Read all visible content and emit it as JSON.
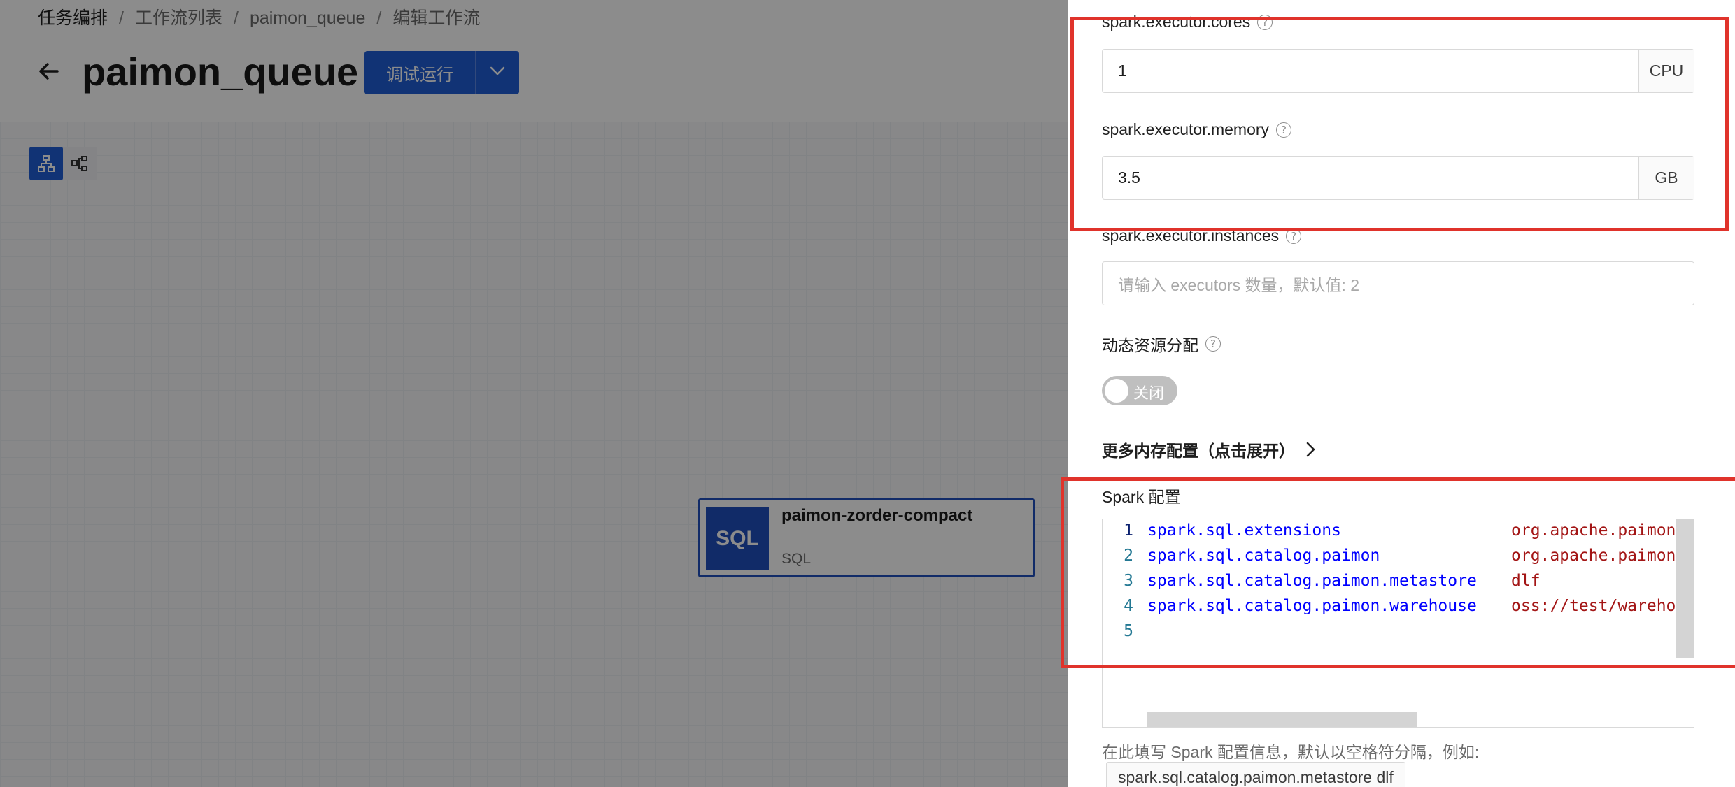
{
  "breadcrumb": {
    "items": [
      "任务编排",
      "工作流列表",
      "paimon_queue",
      "编辑工作流"
    ],
    "separator": "/"
  },
  "workflow": {
    "title": "paimon_queue",
    "run_button": "调试运行"
  },
  "node": {
    "icon_text": "SQL",
    "name": "paimon-zorder-compact",
    "type": "SQL"
  },
  "drawer": {
    "executor_cores": {
      "label": "spark.executor.cores",
      "value": "1",
      "unit": "CPU"
    },
    "executor_memory": {
      "label": "spark.executor.memory",
      "value": "3.5",
      "unit": "GB"
    },
    "executor_instances": {
      "label": "spark.executor.instances",
      "placeholder": "请输入 executors 数量，默认值: 2"
    },
    "dynamic_allocation": {
      "label": "动态资源分配",
      "toggle_text": "关闭",
      "enabled": false
    },
    "more_memory_label": "更多内存配置（点击展开）",
    "spark_config": {
      "label": "Spark 配置",
      "lines": [
        {
          "num": "1",
          "key": "spark.sql.extensions",
          "value": "org.apache.paimon."
        },
        {
          "num": "2",
          "key": "spark.sql.catalog.paimon",
          "value": "org.apache.paimon."
        },
        {
          "num": "3",
          "key": "spark.sql.catalog.paimon.metastore",
          "value": "dlf"
        },
        {
          "num": "4",
          "key": "spark.sql.catalog.paimon.warehouse",
          "value": "oss://test/warehou"
        },
        {
          "num": "5",
          "key": "",
          "value": ""
        }
      ],
      "hint": "在此填写 Spark 配置信息，默认以空格符分隔，例如:",
      "example": "spark.sql.catalog.paimon.metastore dlf"
    }
  },
  "colors": {
    "accent": "#1f5ed6",
    "node_border": "#1f4fbd",
    "annotation": "#e0332b"
  }
}
